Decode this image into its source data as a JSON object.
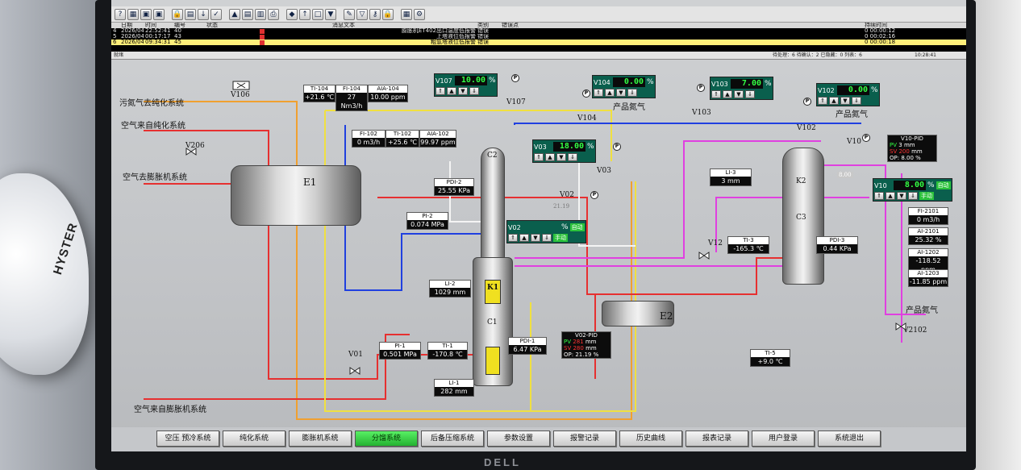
{
  "toolbar": {
    "icons": [
      "help-icon",
      "overview-icon",
      "screen-icon",
      "screen2-icon",
      "lock-icon",
      "trend-icon",
      "down-icon",
      "check-icon",
      "hat-icon",
      "doc-icon",
      "report-icon",
      "print-icon",
      "diamond-icon",
      "up-icon",
      "box-icon",
      "save-icon",
      "edit-icon",
      "filter-icon",
      "key-icon",
      "lock2-icon",
      "calc-icon",
      "settings-icon"
    ]
  },
  "alarms": {
    "headers": {
      "date": "日期",
      "time": "时间",
      "id": "编号",
      "state": "状态",
      "text": "消息文本",
      "category": "类别",
      "note": "错误点",
      "duration": "持续时间"
    },
    "rows": [
      {
        "idx": "4",
        "date": "2026/04/02",
        "time": "22:52:41",
        "id": "40",
        "text": "膨胀机ET402出口温度低报警",
        "category": "错误",
        "duration": "0 00:00:12"
      },
      {
        "idx": "5",
        "date": "2026/04/03",
        "time": "00:17:17",
        "id": "43",
        "text": "上塔液位低报警",
        "category": "错误",
        "duration": "0 00:02:16"
      },
      {
        "idx": "6",
        "date": "2026/04/03",
        "time": "09:34:31",
        "id": "45",
        "text": "粗氩塔液位低报警",
        "category": "错误",
        "duration": "0 00:00:18"
      }
    ]
  },
  "status": {
    "ready": "就绪",
    "counts": "待处理：6  待确认：2  已隐藏：0  列表：6",
    "clock": "10:28:41"
  },
  "labels": {
    "dirty_n2": "污氮气去纯化系统",
    "air_from_purif": "空气来自纯化系统",
    "air_to_exp": "空气去膨胀机系统",
    "air_from_exp": "空气来自膨胀机系统",
    "prod_n2_1": "产品氮气",
    "prod_n2_2": "产品氮气",
    "prod_n2_3": "产品氮气",
    "e1": "E1",
    "e2": "E2",
    "c1": "C1",
    "c2": "C2",
    "c3": "C3",
    "k1": "K1",
    "k2": "K2"
  },
  "valves": {
    "v106": "V106",
    "v206": "V206",
    "v107": "V107",
    "v104": "V104",
    "v103": "V103",
    "v102": "V102",
    "v03": "V03",
    "v02": "V02",
    "v01": "V01",
    "v12": "V12",
    "v10": "V10",
    "v2102": "V2102"
  },
  "ctl": {
    "v107": {
      "name": "V107",
      "value": "10.00",
      "unit": "%"
    },
    "v104": {
      "name": "V104",
      "value": "0.00",
      "unit": "%"
    },
    "v103": {
      "name": "V103",
      "value": "7.00",
      "unit": "%"
    },
    "v102": {
      "name": "V102",
      "value": "0.00",
      "unit": "%"
    },
    "v03": {
      "name": "V03",
      "value": "18.00",
      "unit": "%"
    },
    "v02": {
      "name": "V02",
      "value": "",
      "unit": "%",
      "mode1": "自动",
      "mode2": "手动"
    },
    "v10": {
      "name": "V10",
      "value": "8.00",
      "unit": "%",
      "mode1": "自动",
      "mode2": "手动"
    }
  },
  "ghost": {
    "v02": "21.19",
    "v10": "8.00"
  },
  "panels": {
    "ti104": {
      "h": "TI-104",
      "v": "+21.6",
      "u": "℃"
    },
    "fi104": {
      "h": "FI-104",
      "v": "27",
      "u": "Nm3/h"
    },
    "aia104": {
      "h": "AIA-104",
      "v": "10.00",
      "u": "ppm"
    },
    "fi102": {
      "h": "FI-102",
      "v": "0",
      "u": "m3/h"
    },
    "ti102": {
      "h": "TI-102",
      "v": "+25.6",
      "u": "℃"
    },
    "aia102": {
      "h": "AIA-102",
      "v": "99.97",
      "u": "ppm"
    },
    "pdi2": {
      "h": "PDI-2",
      "v": "25.55",
      "u": "KPa"
    },
    "pi2": {
      "h": "PI-2",
      "v": "0.074",
      "u": "MPa"
    },
    "li2": {
      "h": "LI-2",
      "v": "1029",
      "u": "mm"
    },
    "pi1": {
      "h": "PI-1",
      "v": "0.501",
      "u": "MPa"
    },
    "ti1": {
      "h": "TI-1",
      "v": "-170.8",
      "u": "℃"
    },
    "pdi1": {
      "h": "PDI-1",
      "v": "6.47",
      "u": "KPa"
    },
    "li1": {
      "h": "LI-1",
      "v": "282",
      "u": "mm"
    },
    "li3": {
      "h": "LI-3",
      "v": "3",
      "u": "mm"
    },
    "ti3": {
      "h": "TI-3",
      "v": "-165.3",
      "u": "℃"
    },
    "pdi3": {
      "h": "PDI-3",
      "v": "0.44",
      "u": "KPa"
    },
    "ti5": {
      "h": "TI-5",
      "v": "+9.0",
      "u": "℃"
    },
    "fi2101": {
      "h": "FI-2101",
      "v": "0",
      "u": "m3/h"
    },
    "ai2101": {
      "h": "AI-2101",
      "v": "25.32",
      "u": "%"
    },
    "ai1202": {
      "h": "AI-1202",
      "v": "-118.52",
      "u": "ppm"
    },
    "ai1203": {
      "h": "AI-1203",
      "v": "-11.85",
      "u": "ppm"
    }
  },
  "pid": {
    "v02": {
      "title": "V02-PID",
      "pv_l": "PV",
      "pv": "281",
      "pv_u": "mm",
      "sv_l": "SV",
      "sv": "280",
      "sv_u": "mm",
      "op_l": "OP:",
      "op": "21.19",
      "op_u": "%"
    },
    "v10": {
      "title": "V10-PID",
      "pv_l": "PV",
      "pv": "3",
      "pv_u": "mm",
      "sv_l": "SV",
      "sv": "200",
      "sv_u": "mm",
      "op_l": "OP:",
      "op": "8.00",
      "op_u": "%"
    }
  },
  "nav": [
    "空压 预冷系统",
    "纯化系统",
    "膨胀机系统",
    "分馏系统",
    "后备压缩系统",
    "参数设置",
    "报警记录",
    "历史曲线",
    "报表记录",
    "用户登录",
    "系统退出"
  ],
  "nav_active": 3,
  "photo": {
    "helmet_brand": "HYSTER",
    "monitor_brand": "DELL"
  }
}
